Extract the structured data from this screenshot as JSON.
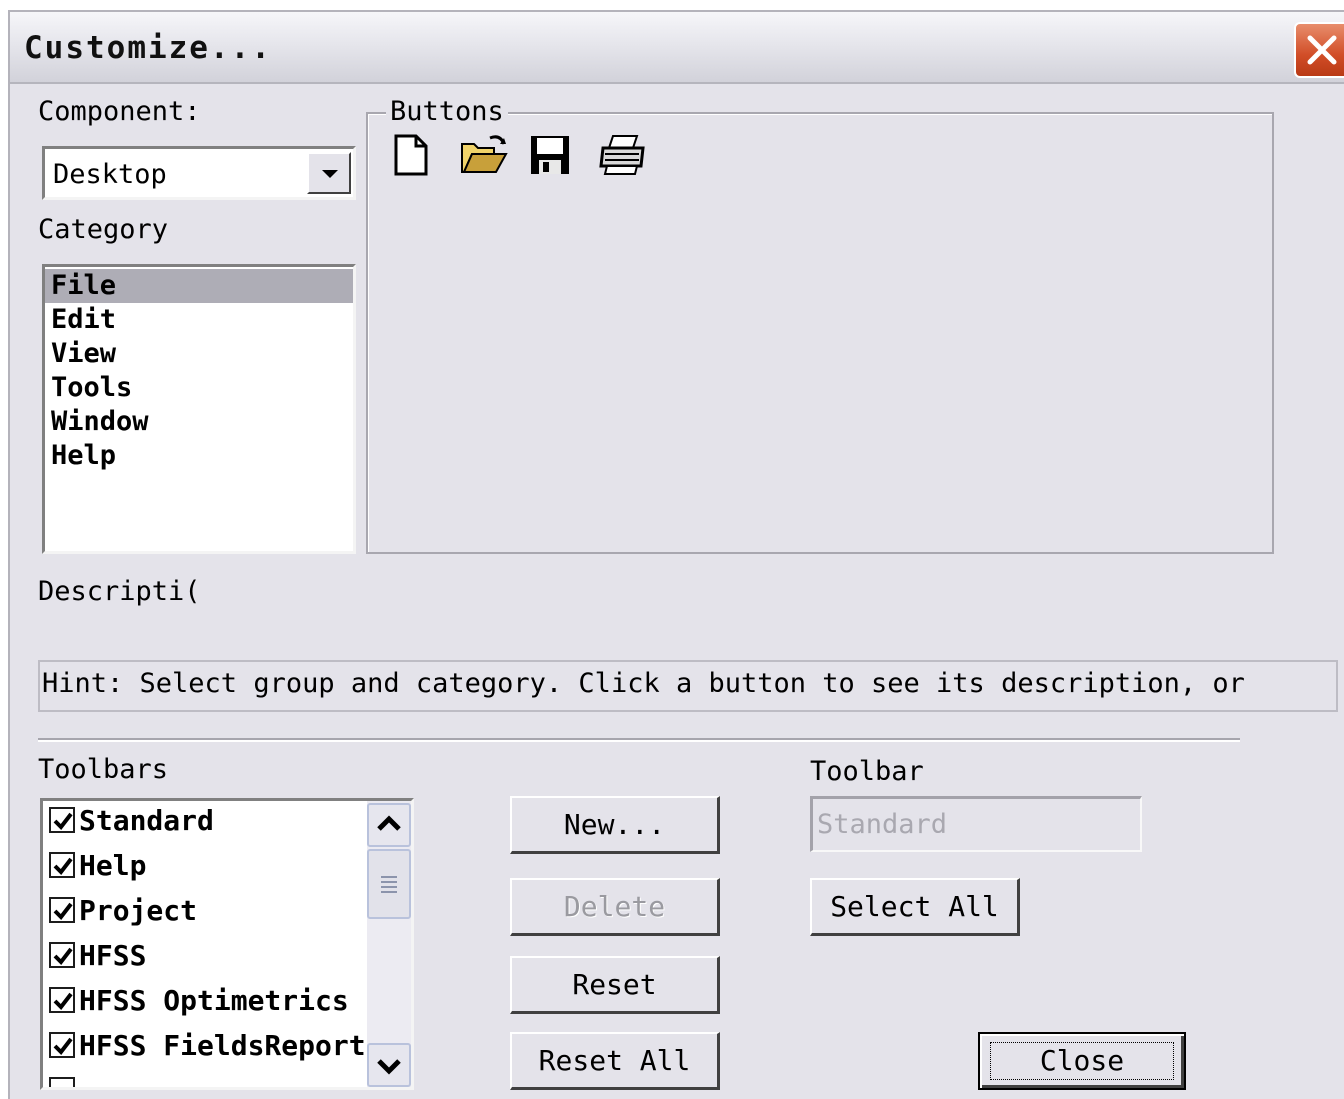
{
  "window": {
    "title": "Customize..."
  },
  "component": {
    "label": "Component:",
    "value": "Desktop"
  },
  "category": {
    "label": "Category",
    "items": [
      "File",
      "Edit",
      "View",
      "Tools",
      "Window",
      "Help"
    ],
    "selected": "File"
  },
  "buttons_group": {
    "label": "Buttons",
    "icons": [
      "new-document-icon",
      "open-folder-icon",
      "save-disk-icon",
      "print-icon"
    ]
  },
  "description": {
    "label": "Descripti(",
    "hint": "Hint: Select group and category. Click a button to see its description, or"
  },
  "toolbars": {
    "label": "Toolbars",
    "items": [
      {
        "name": "Standard",
        "checked": true
      },
      {
        "name": "Help",
        "checked": true
      },
      {
        "name": "Project",
        "checked": true
      },
      {
        "name": "HFSS",
        "checked": true
      },
      {
        "name": "HFSS Optimetrics",
        "checked": true
      },
      {
        "name": "HFSS FieldsReport",
        "checked": true
      }
    ]
  },
  "actions": {
    "new": "New...",
    "delete": "Delete",
    "reset": "Reset",
    "reset_all": "Reset All",
    "select_all": "Select All",
    "close": "Close"
  },
  "toolbar_name": {
    "label": "Toolbar",
    "value": "Standard"
  }
}
